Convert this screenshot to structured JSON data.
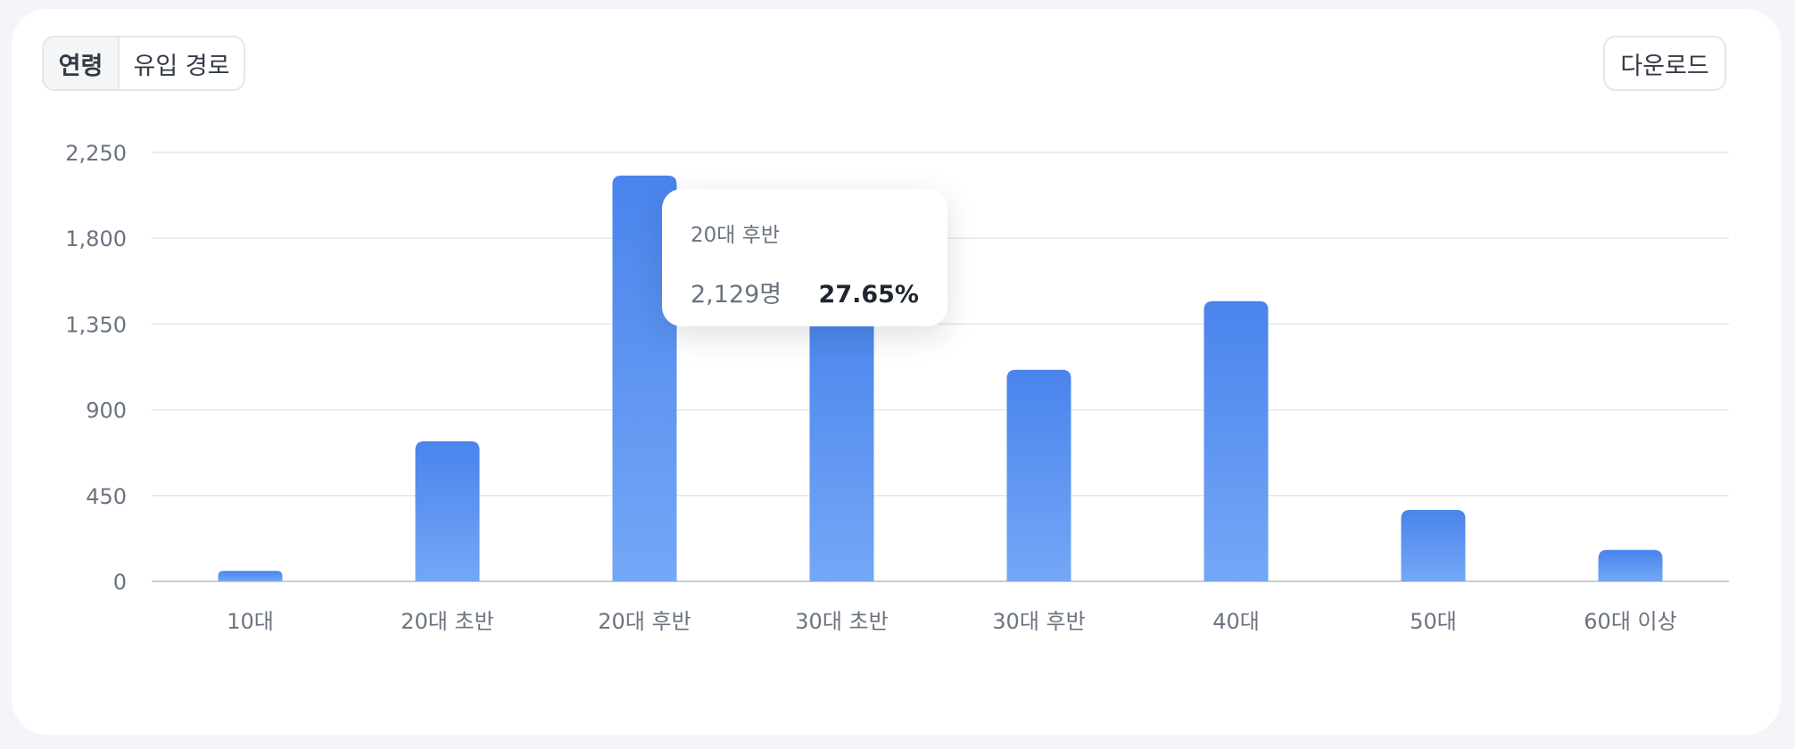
{
  "tabs": [
    {
      "label": "연령",
      "active": true
    },
    {
      "label": "유입 경로",
      "active": false
    }
  ],
  "download_label": "다운로드",
  "tooltip": {
    "category": "20대 후반",
    "count": "2,129명",
    "percent": "27.65%"
  },
  "colors": {
    "bar_top": "#4a84ec",
    "bar_bottom": "#74a7f7",
    "grid": "#e5e7eb",
    "axis": "#c9cdd3",
    "tick_text": "#6b7380"
  },
  "chart_data": {
    "type": "bar",
    "categories": [
      "10대",
      "20대 초반",
      "20대 후반",
      "30대 초반",
      "30대 후반",
      "40대",
      "50대",
      "60대 이상"
    ],
    "values": [
      55,
      735,
      2129,
      1470,
      1110,
      1470,
      375,
      165
    ],
    "yticks": [
      "0",
      "450",
      "900",
      "1,350",
      "1,800",
      "2,250"
    ],
    "ylim": [
      0,
      2250
    ],
    "grid": true,
    "title": "",
    "xlabel": "",
    "ylabel": ""
  }
}
